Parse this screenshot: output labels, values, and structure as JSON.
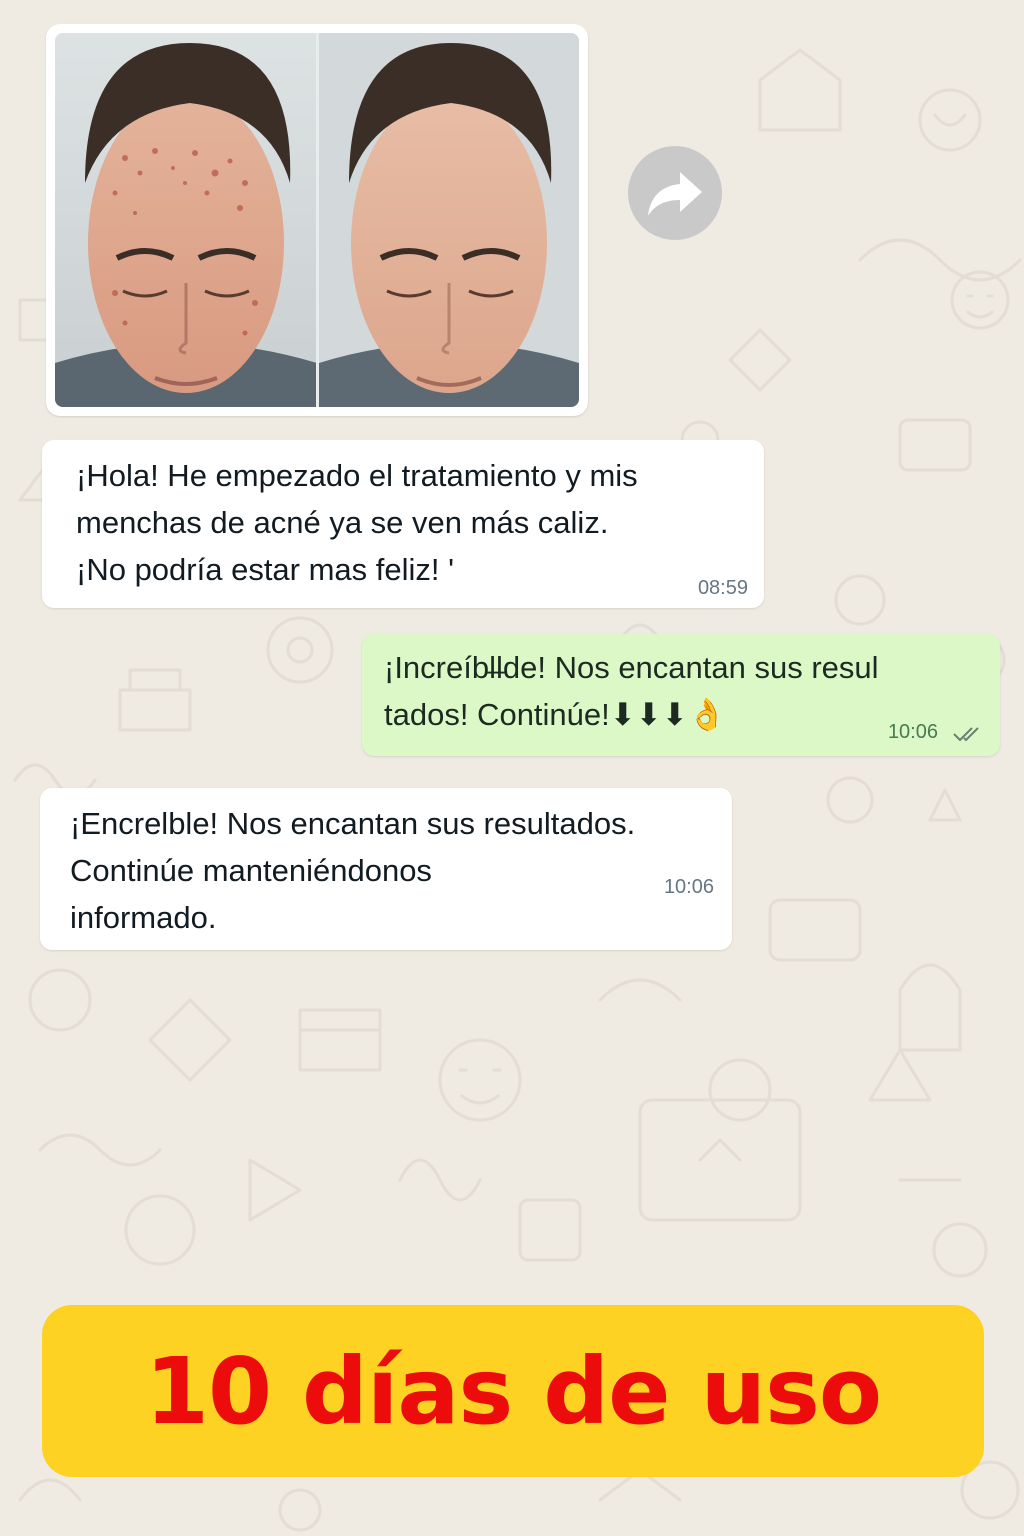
{
  "chat": {
    "image_message": {
      "forward_icon": "forward-arrow-icon"
    },
    "messages": [
      {
        "direction": "incoming",
        "text": "¡Hola! He empezado el tratamiento y mis\nmenchas de acné ya se ven más caliz.\n¡No podría estar mas feliz! '",
        "time": "08:59"
      },
      {
        "direction": "outgoing",
        "text": "¡Increíbl͏̶l͏d͏e! Nos encantan sus resu͏l͏\ntados! Continúe!⬇⬇⬇👌",
        "time": "10:06",
        "status_icon": "double-check-icon"
      },
      {
        "direction": "incoming",
        "text": "¡Encrelble! Nos encantan sus resultados.\nContinúe manteniéndonos\ninformado.",
        "time": "10:06"
      }
    ]
  },
  "banner": {
    "text": "10 días de uso"
  },
  "colors": {
    "chat_background": "#efeae2",
    "incoming_bubble": "#ffffff",
    "outgoing_bubble": "#dcf8c6",
    "banner_background": "#fdd223",
    "banner_text": "#ec0c0c"
  }
}
